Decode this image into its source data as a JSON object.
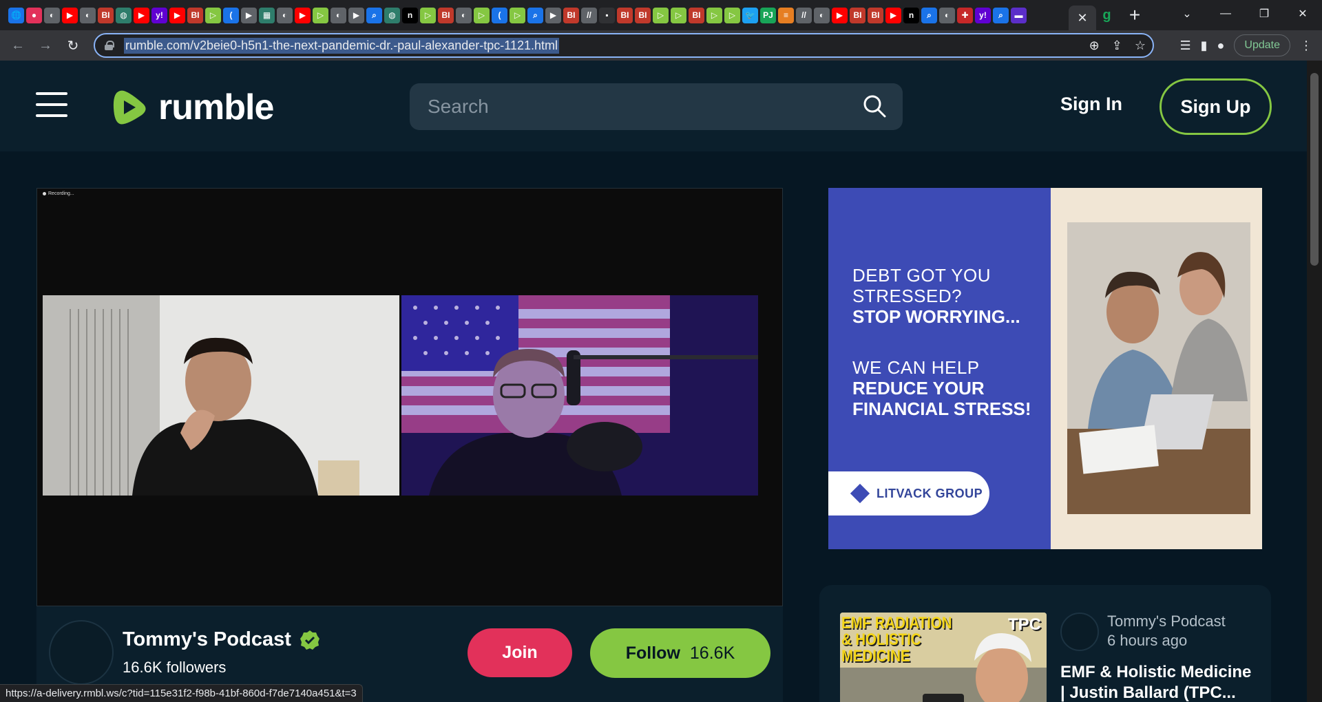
{
  "browser": {
    "tab_close": "✕",
    "new_tab": "+",
    "url": "rumble.com/v2beie0-h5n1-the-next-pandemic-dr.-paul-alexander-tpc-1121.html",
    "update_label": "Update",
    "status_url": "https://a-delivery.rmbl.ws/c?tid=115e31f2-f98b-41bf-860d-f7de7140a451&t=3",
    "tab_favicons": [
      {
        "glyph": "🌐",
        "color": "#1a73e8"
      },
      {
        "glyph": "●",
        "color": "#e2315a"
      },
      {
        "glyph": "◐",
        "color": "#5f6368"
      },
      {
        "glyph": "▶",
        "color": "#ff0000"
      },
      {
        "glyph": "◐",
        "color": "#5f6368"
      },
      {
        "glyph": "BI",
        "color": "#c0392b"
      },
      {
        "glyph": "◍",
        "color": "#2e7d6b"
      },
      {
        "glyph": "▶",
        "color": "#ff0000"
      },
      {
        "glyph": "y!",
        "color": "#6001d2"
      },
      {
        "glyph": "▶",
        "color": "#ff0000"
      },
      {
        "glyph": "BI",
        "color": "#c0392b"
      },
      {
        "glyph": "▷",
        "color": "#85c742"
      },
      {
        "glyph": "(",
        "color": "#1a73e8"
      },
      {
        "glyph": "▶",
        "color": "#5f6368"
      },
      {
        "glyph": "▦",
        "color": "#2e7d6b"
      },
      {
        "glyph": "◐",
        "color": "#5f6368"
      },
      {
        "glyph": "▶",
        "color": "#ff0000"
      },
      {
        "glyph": "▷",
        "color": "#85c742"
      },
      {
        "glyph": "◐",
        "color": "#5f6368"
      },
      {
        "glyph": "▶",
        "color": "#5f6368"
      },
      {
        "glyph": "⌕",
        "color": "#1a73e8"
      },
      {
        "glyph": "◍",
        "color": "#2e7d6b"
      },
      {
        "glyph": "n",
        "color": "#000000"
      },
      {
        "glyph": "▷",
        "color": "#85c742"
      },
      {
        "glyph": "BI",
        "color": "#c0392b"
      },
      {
        "glyph": "◐",
        "color": "#5f6368"
      },
      {
        "glyph": "▷",
        "color": "#85c742"
      },
      {
        "glyph": "(",
        "color": "#1a73e8"
      },
      {
        "glyph": "▷",
        "color": "#85c742"
      },
      {
        "glyph": "⌕",
        "color": "#1a73e8"
      },
      {
        "glyph": "▶",
        "color": "#5f6368"
      },
      {
        "glyph": "BI",
        "color": "#c0392b"
      },
      {
        "glyph": "//",
        "color": "#5f6368"
      },
      {
        "glyph": "▪",
        "color": "#303134"
      },
      {
        "glyph": "BI",
        "color": "#c0392b"
      },
      {
        "glyph": "BI",
        "color": "#c0392b"
      },
      {
        "glyph": "▷",
        "color": "#85c742"
      },
      {
        "glyph": "▷",
        "color": "#85c742"
      },
      {
        "glyph": "BI",
        "color": "#c0392b"
      },
      {
        "glyph": "▷",
        "color": "#85c742"
      },
      {
        "glyph": "▷",
        "color": "#85c742"
      },
      {
        "glyph": "🐦",
        "color": "#1da1f2"
      },
      {
        "glyph": "PJ",
        "color": "#18a558"
      },
      {
        "glyph": "≡",
        "color": "#e67e22"
      },
      {
        "glyph": "//",
        "color": "#5f6368"
      },
      {
        "glyph": "◐",
        "color": "#5f6368"
      },
      {
        "glyph": "▶",
        "color": "#ff0000"
      },
      {
        "glyph": "BI",
        "color": "#c0392b"
      },
      {
        "glyph": "BI",
        "color": "#c0392b"
      },
      {
        "glyph": "▶",
        "color": "#ff0000"
      },
      {
        "glyph": "n",
        "color": "#000000"
      },
      {
        "glyph": "⌕",
        "color": "#1a73e8"
      },
      {
        "glyph": "◐",
        "color": "#5f6368"
      },
      {
        "glyph": "✚",
        "color": "#c62828"
      },
      {
        "glyph": "y!",
        "color": "#6001d2"
      },
      {
        "glyph": "⌕",
        "color": "#1a73e8"
      },
      {
        "glyph": "▬",
        "color": "#5b2ec9"
      }
    ],
    "last_tab_glyph": "g",
    "last_tab_color": "#18a558"
  },
  "site": {
    "logo_text": "rumble",
    "search_placeholder": "Search",
    "signin_label": "Sign In",
    "signup_label": "Sign Up",
    "accent": "#85c742"
  },
  "video": {
    "recording_label": "Recording..."
  },
  "channel": {
    "name": "Tommy's Podcast",
    "followers": "16.6K followers",
    "join_label": "Join",
    "follow_label": "Follow",
    "follow_count": "16.6K"
  },
  "ad": {
    "line1": "DEBT GOT YOU",
    "line2": "STRESSED?",
    "line3": "STOP WORRYING...",
    "line4": "WE CAN HELP",
    "line5": "REDUCE YOUR",
    "line6": "FINANCIAL STRESS!",
    "brand": "LITVACK GROUP"
  },
  "related": {
    "thumb_title": "EMF RADIATION & HOLISTIC MEDICINE",
    "thumb_badge": "TPC",
    "channel": "Tommy's Podcast",
    "time": "6 hours ago",
    "title": "EMF & Holistic Medicine | Justin Ballard (TPC..."
  }
}
